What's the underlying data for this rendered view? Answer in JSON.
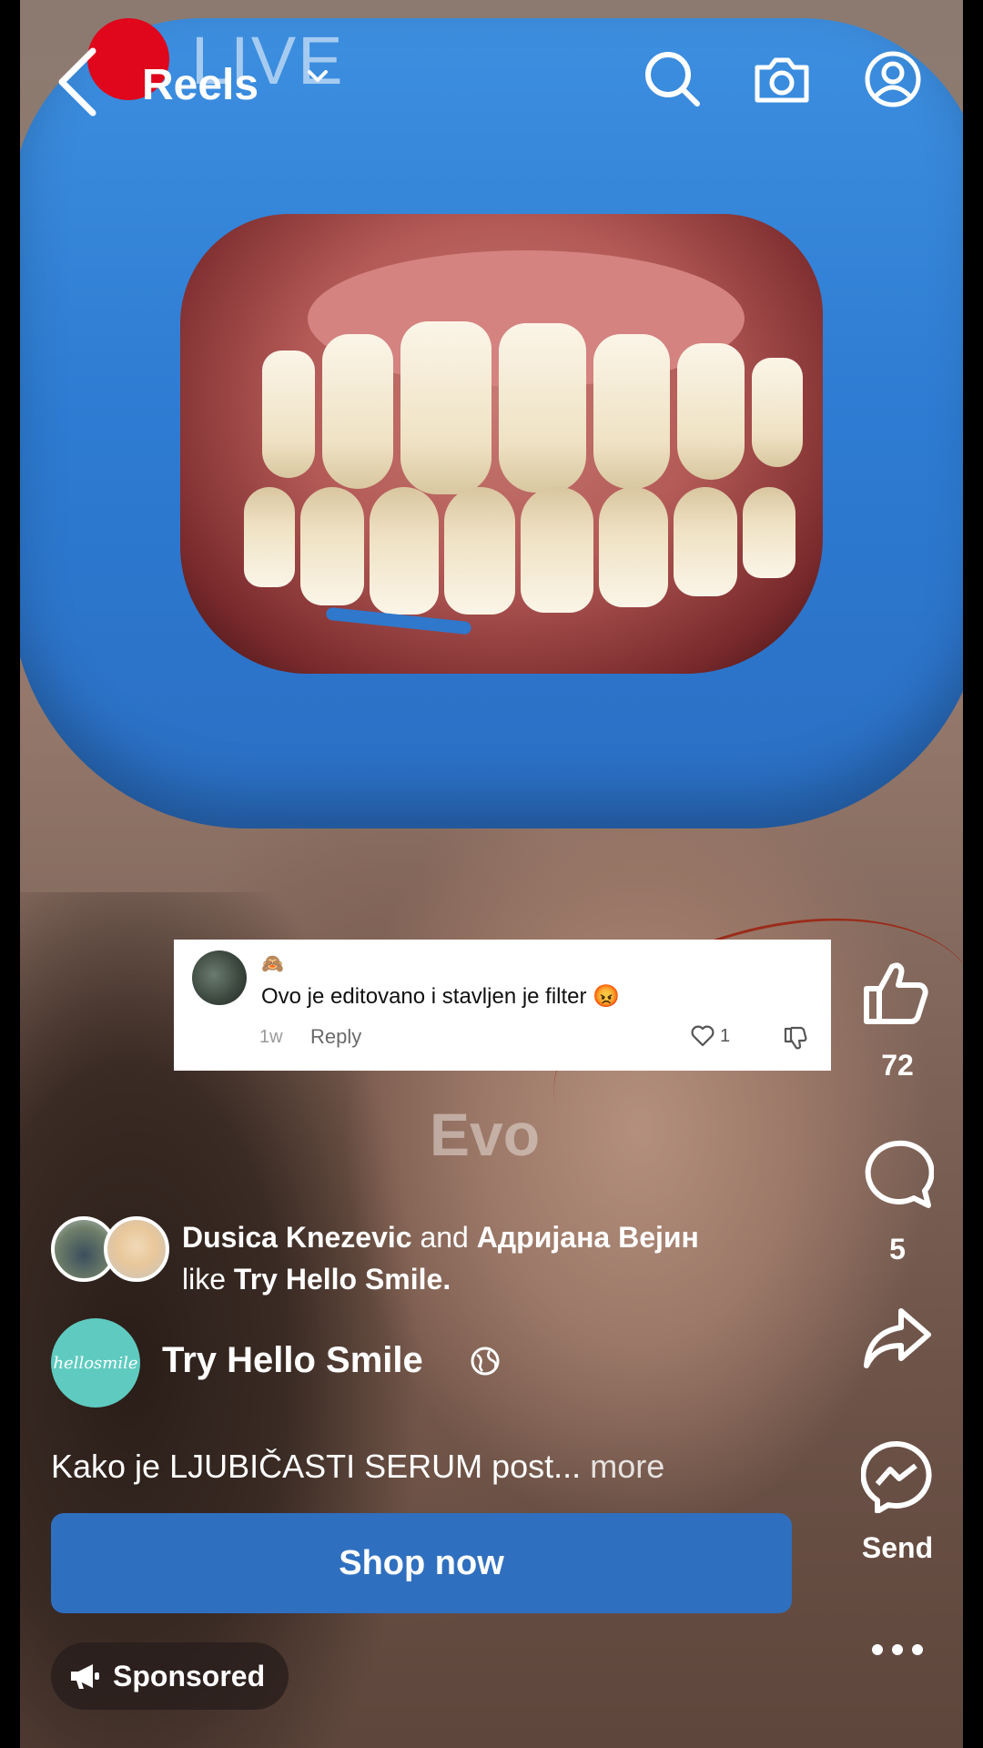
{
  "status": {
    "live_label": "LIVE"
  },
  "header": {
    "title": "Reels"
  },
  "comment": {
    "emoji": "🙈",
    "text": "Ovo je editovano i stavljen je filter 😡",
    "time": "1w",
    "reply_label": "Reply",
    "likes": "1"
  },
  "overlay_text": "Evo",
  "actions": {
    "like_count": "72",
    "comment_count": "5",
    "send_label": "Send"
  },
  "social": {
    "liker_1": "Dusica Knezevic",
    "and": "and",
    "liker_2": "Адријана Вејин",
    "like": "like",
    "page": "Try Hello Smile."
  },
  "post": {
    "brand_avatar_text": "hellosmile",
    "brand_name": "Try Hello Smile",
    "caption": "Kako je LJUBIČASTI SERUM post...",
    "more_label": "more",
    "cta_label": "Shop now",
    "sponsored_label": "Sponsored"
  },
  "colors": {
    "cta": "#2f6fbf",
    "brand_avatar": "#5fcbc0",
    "retractor": "#3d8fe0",
    "live": "#e0061b"
  },
  "icons": [
    "back-icon",
    "chevron-down-icon",
    "search-icon",
    "camera-icon",
    "profile-icon",
    "thumbs-up-icon",
    "comment-icon",
    "share-icon",
    "messenger-icon",
    "more-icon",
    "globe-icon",
    "megaphone-icon",
    "heart-icon",
    "dislike-icon"
  ]
}
